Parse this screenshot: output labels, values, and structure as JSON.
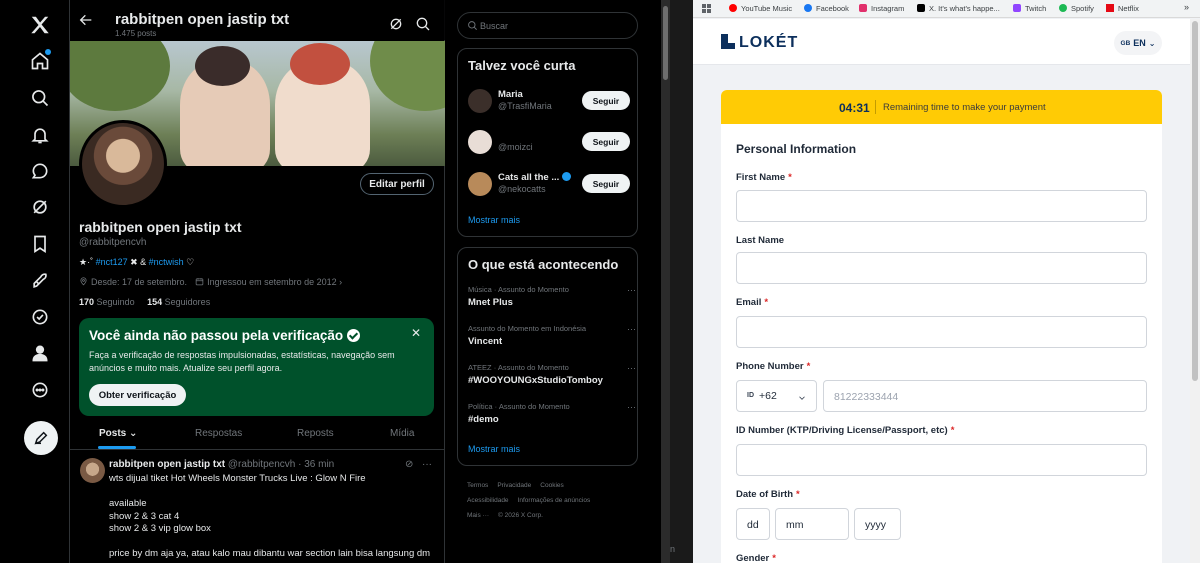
{
  "x": {
    "header": {
      "title": "rabbitpen open jastip txt",
      "post_count": "1.475 posts"
    },
    "profile": {
      "name": "rabbitpen open jastip txt",
      "handle": "@rabbitpencvh",
      "edit_button": "Editar perfil",
      "bio_prefix": "★·˚ ",
      "bio_tag1": "#nct127",
      "bio_mid": " ✖ & ",
      "bio_tag2": "#nctwish",
      "bio_suffix": " ♡",
      "since": "Desde: 17 de setembro.",
      "joined": "Ingressou em setembro de 2012",
      "following_count": "170",
      "following_label": "Seguindo",
      "followers_count": "154",
      "followers_label": "Seguidores"
    },
    "verify": {
      "title": "Você ainda não passou pela verificação",
      "text": "Faça a verificação de respostas impulsionadas, estatísticas, navegação sem anúncios e muito mais. Atualize seu perfil agora.",
      "button": "Obter verificação",
      "close": "✕"
    },
    "tabs": [
      "Posts",
      "Respostas",
      "Reposts",
      "Mídia"
    ],
    "tweet": {
      "name": "rabbitpen open jastip txt",
      "handle": "@rabbitpencvh",
      "time": "· 36 min",
      "body": "wts dijual tiket Hot Wheels Monster Trucks Live : Glow N Fire\n\navailable\nshow 2 & 3 cat 4\nshow 2 & 3 vip glow box\n\nprice by dm aja ya, atau kalo mau dibantu war section lain bisa langsung dm"
    },
    "search_placeholder": "Buscar",
    "who_to_follow": {
      "title": "Talvez você curta",
      "users": [
        {
          "name": "Maria",
          "handle": "@TrasfiMaria",
          "button": "Seguir",
          "color": "#3b2f2a"
        },
        {
          "name": "",
          "handle": "@moizci",
          "button": "Seguir",
          "color": "#e8ddd6"
        },
        {
          "name": "Cats all the ...",
          "handle": "@nekocatts",
          "button": "Seguir",
          "color": "#b88a5a"
        }
      ],
      "more": "Mostrar mais"
    },
    "trends": {
      "title": "O que está acontecendo",
      "items": [
        {
          "meta": "Música · Assunto do Momento",
          "name": "Mnet Plus"
        },
        {
          "meta": "Assunto do Momento em Indonésia",
          "name": "Vincent"
        },
        {
          "meta": "ATEEZ · Assunto do Momento",
          "name": "#WOOYOUNGxStudioTomboy"
        },
        {
          "meta": "Política · Assunto do Momento",
          "name": "#demo"
        }
      ],
      "more": "Mostrar mais"
    },
    "footer": [
      "Termos",
      "Privacidade",
      "Cookies",
      "Acessibilidade",
      "Informações de anúncios",
      "Mais ···",
      "© 2026 X Corp."
    ],
    "edge_text": "n"
  },
  "browser": {
    "bookmarks": [
      {
        "label": "YouTube Music",
        "color": "#ff0000"
      },
      {
        "label": "Facebook",
        "color": "#1877f2"
      },
      {
        "label": "Instagram",
        "color": "#e1306c"
      },
      {
        "label": "X. It's what's happe...",
        "color": "#000000"
      },
      {
        "label": "Twitch",
        "color": "#9146ff"
      },
      {
        "label": "Spotify",
        "color": "#1db954"
      },
      {
        "label": "Netflix",
        "color": "#e50914"
      }
    ],
    "bookmarks_more": "»"
  },
  "loket": {
    "brand": "LOKÉT",
    "lang_flag": "GB",
    "lang": "EN",
    "timer": "04:31",
    "timer_text": "Remaining time to make your payment",
    "section_title": "Personal Information",
    "fields": {
      "first_name": "First Name",
      "last_name": "Last Name",
      "email": "Email",
      "phone": "Phone Number",
      "id_number": "ID Number (KTP/Driving License/Passport, etc)",
      "dob": "Date of Birth",
      "gender": "Gender"
    },
    "required_mark": "*",
    "phone_flag": "ID",
    "phone_code": "+62",
    "phone_placeholder": "81222333444",
    "dob_day": "dd",
    "dob_month": "mm",
    "dob_year": "yyyy"
  }
}
